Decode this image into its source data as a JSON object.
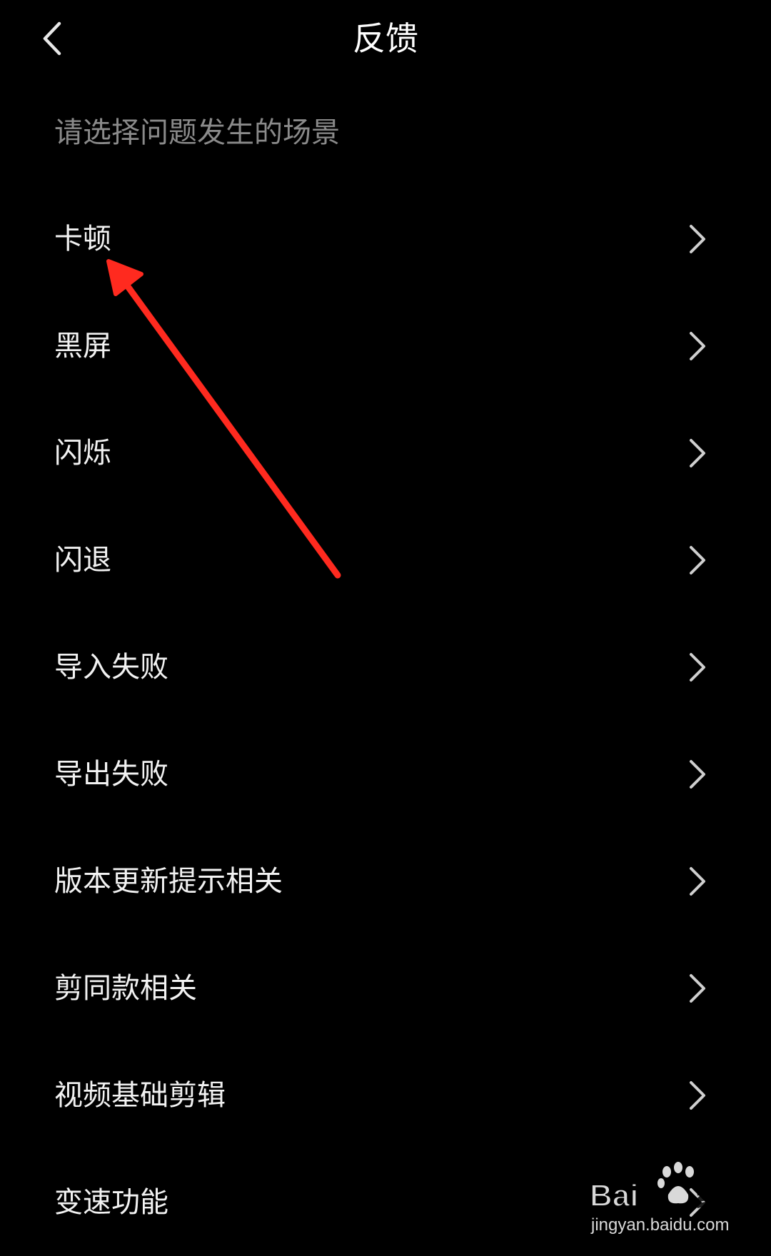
{
  "header": {
    "title": "反馈",
    "back_icon": "chevron-left-icon"
  },
  "section": {
    "title": "请选择问题发生的场景"
  },
  "items": [
    {
      "label": "卡顿"
    },
    {
      "label": "黑屏"
    },
    {
      "label": "闪烁"
    },
    {
      "label": "闪退"
    },
    {
      "label": "导入失败"
    },
    {
      "label": "导出失败"
    },
    {
      "label": "版本更新提示相关"
    },
    {
      "label": "剪同款相关"
    },
    {
      "label": "视频基础剪辑"
    },
    {
      "label": "变速功能"
    }
  ],
  "colors": {
    "background": "#000000",
    "text_primary": "#f2f2f2",
    "text_secondary": "#8a8a8a",
    "chevron": "#cfcfcf",
    "annotation": "#ff2a1f"
  },
  "watermark": {
    "brand": "Baidu经验",
    "url": "jingyan.baidu.com"
  }
}
